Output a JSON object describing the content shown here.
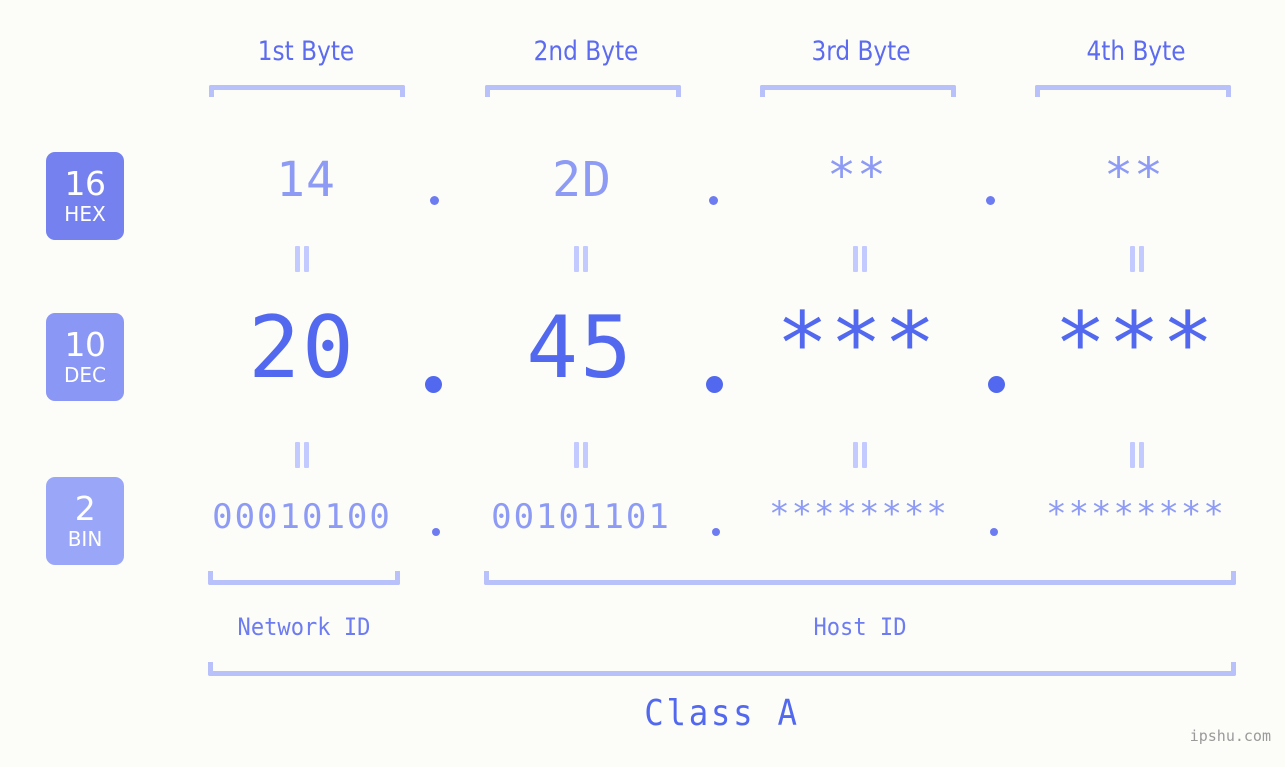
{
  "background_color": "#fcfdf9",
  "accent_colors": {
    "strong": "#5269ef",
    "medium": "#8e9bf5",
    "light": "#b9c1fb",
    "badge_hex": "#7481ef",
    "badge_dec": "#8a97f4",
    "badge_bin": "#9aa7f8"
  },
  "byte_headers": [
    {
      "label": "1st Byte"
    },
    {
      "label": "2nd Byte"
    },
    {
      "label": "3rd Byte"
    },
    {
      "label": "4th Byte"
    }
  ],
  "bases": [
    {
      "num": "16",
      "label": "HEX"
    },
    {
      "num": "10",
      "label": "DEC"
    },
    {
      "num": "2",
      "label": "BIN"
    }
  ],
  "rows": {
    "hex": {
      "values": [
        "14",
        "2D",
        "**",
        "**"
      ],
      "separators": [
        ".",
        ".",
        "."
      ]
    },
    "dec": {
      "values": [
        "20",
        "45",
        "***",
        "***"
      ],
      "separators": [
        ".",
        ".",
        "."
      ]
    },
    "bin": {
      "values": [
        "00010100",
        "00101101",
        "********",
        "********"
      ],
      "separators": [
        ".",
        ".",
        "."
      ]
    }
  },
  "equals_symbol": "=",
  "segments": {
    "network_id": "Network ID",
    "host_id": "Host ID",
    "class": "Class A"
  },
  "watermark": "ipshu.com"
}
